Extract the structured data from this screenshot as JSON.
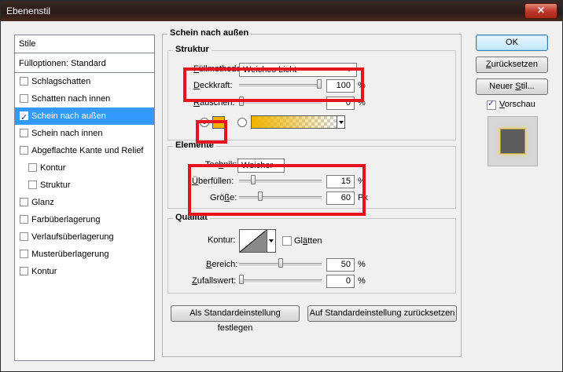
{
  "window": {
    "title": "Ebenenstil",
    "close_glyph": "✕"
  },
  "sidebar": {
    "header": "Stile",
    "options": "Fülloptionen: Standard",
    "items": [
      {
        "label": "Schlagschatten",
        "checked": false,
        "selected": false,
        "indent": false
      },
      {
        "label": "Schatten nach innen",
        "checked": false,
        "selected": false,
        "indent": false
      },
      {
        "label": "Schein nach außen",
        "checked": true,
        "selected": true,
        "indent": false
      },
      {
        "label": "Schein nach innen",
        "checked": false,
        "selected": false,
        "indent": false
      },
      {
        "label": "Abgeflachte Kante und Relief",
        "checked": false,
        "selected": false,
        "indent": false
      },
      {
        "label": "Kontur",
        "checked": false,
        "selected": false,
        "indent": true
      },
      {
        "label": "Struktur",
        "checked": false,
        "selected": false,
        "indent": true
      },
      {
        "label": "Glanz",
        "checked": false,
        "selected": false,
        "indent": false
      },
      {
        "label": "Farbüberlagerung",
        "checked": false,
        "selected": false,
        "indent": false
      },
      {
        "label": "Verlaufsüberlagerung",
        "checked": false,
        "selected": false,
        "indent": false
      },
      {
        "label": "Musterüberlagerung",
        "checked": false,
        "selected": false,
        "indent": false
      },
      {
        "label": "Kontur",
        "checked": false,
        "selected": false,
        "indent": false
      }
    ]
  },
  "main": {
    "title": "Schein nach außen",
    "struktur": {
      "legend": "Struktur",
      "fuellmethode_label": "Füllmethode:",
      "fuellmethode_value": "Weiches Licht",
      "deckkraft_label": "Deckkraft:",
      "deckkraft_value": "100",
      "deckkraft_unit": "%",
      "deckkraft_fraction": 1.0,
      "rauschen_label": "Rauschen:",
      "rauschen_value": "0",
      "rauschen_unit": "%",
      "rauschen_fraction": 0.0,
      "color_swatch": "#f0b400"
    },
    "elemente": {
      "legend": "Elemente",
      "technik_label": "Technik:",
      "technik_value": "Weicher",
      "ueberfuellen_label": "Überfüllen:",
      "ueberfuellen_value": "15",
      "ueberfuellen_unit": "%",
      "ueberfuellen_fraction": 0.15,
      "groesse_label": "Größe:",
      "groesse_value": "60",
      "groesse_unit": "Px",
      "groesse_fraction": 0.24
    },
    "qualitaet": {
      "legend": "Qualität",
      "kontur_label": "Kontur:",
      "glaetten_label": "Glätten",
      "bereich_label": "Bereich:",
      "bereich_value": "50",
      "bereich_unit": "%",
      "bereich_fraction": 0.5,
      "zufallswert_label": "Zufallswert:",
      "zufallswert_value": "0",
      "zufallswert_unit": "%",
      "zufallswert_fraction": 0.0
    },
    "buttons": {
      "set_default": "Als Standardeinstellung festlegen",
      "reset_default": "Auf Standardeinstellung zurücksetzen"
    }
  },
  "right": {
    "ok": "OK",
    "reset": "Zurücksetzen",
    "new_style": "Neuer Stil...",
    "preview_label": "Vorschau",
    "preview_checked": true
  },
  "colors": {
    "highlight": "#e8111e",
    "selection": "#3399ff",
    "glow": "#f0b400"
  }
}
